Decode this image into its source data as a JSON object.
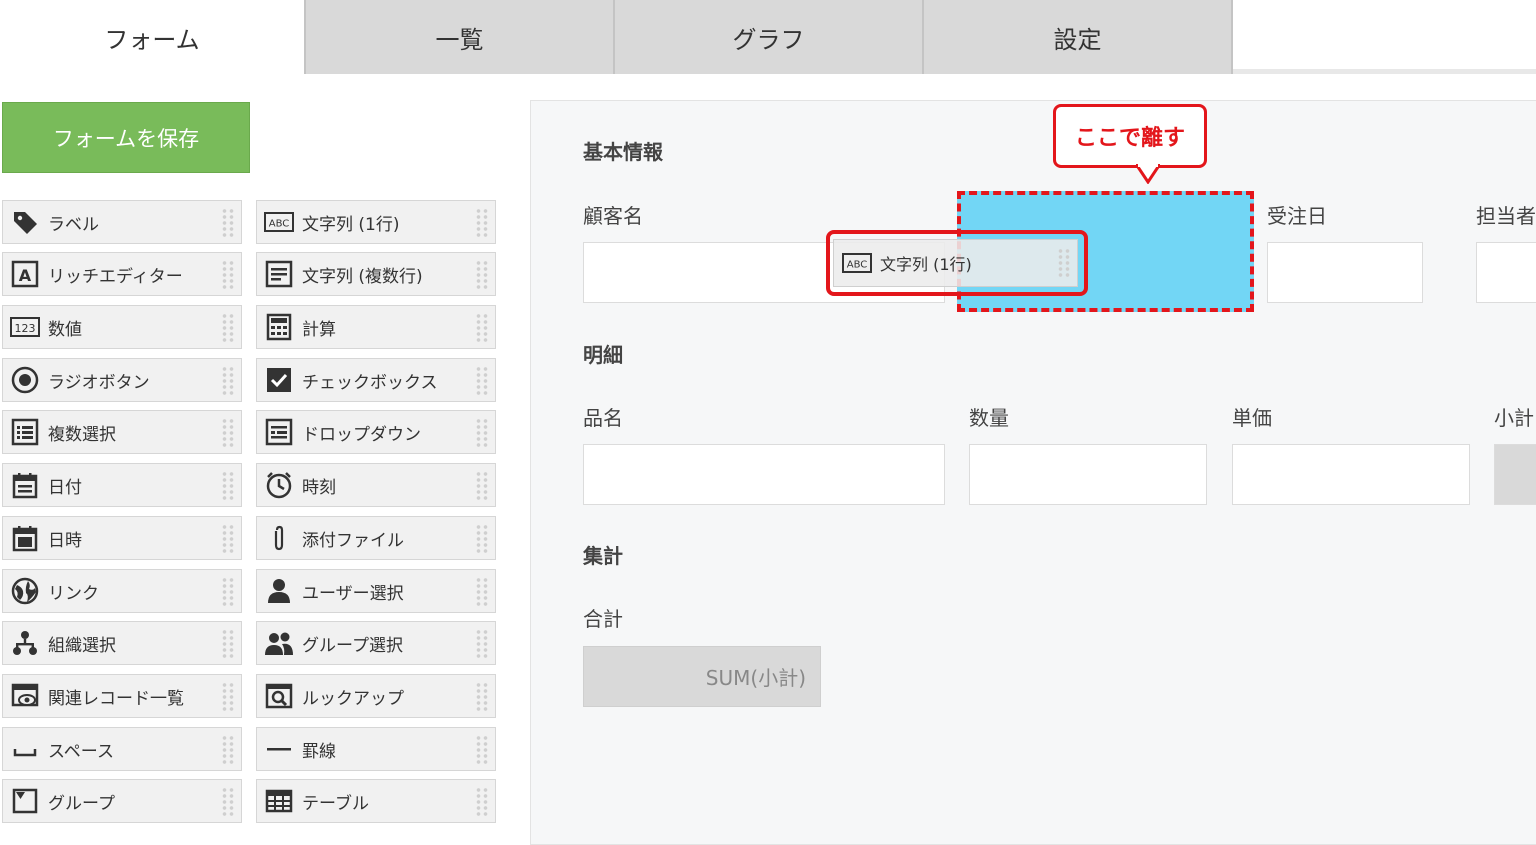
{
  "tabs": [
    {
      "label": "フォーム",
      "active": true
    },
    {
      "label": "一覧",
      "active": false
    },
    {
      "label": "グラフ",
      "active": false
    },
    {
      "label": "設定",
      "active": false
    }
  ],
  "save_button": {
    "label": "フォームを保存",
    "color": "#79bb5a"
  },
  "palette": {
    "left": [
      {
        "label": "ラベル",
        "icon": "tag-icon"
      },
      {
        "label": "リッチエディター",
        "icon": "rich-editor-icon"
      },
      {
        "label": "数値",
        "icon": "number-icon"
      },
      {
        "label": "ラジオボタン",
        "icon": "radio-icon"
      },
      {
        "label": "複数選択",
        "icon": "multi-select-icon"
      },
      {
        "label": "日付",
        "icon": "date-icon"
      },
      {
        "label": "日時",
        "icon": "datetime-icon"
      },
      {
        "label": "リンク",
        "icon": "globe-icon"
      },
      {
        "label": "組織選択",
        "icon": "org-icon"
      },
      {
        "label": "関連レコード一覧",
        "icon": "related-records-icon"
      },
      {
        "label": "スペース",
        "icon": "space-icon"
      },
      {
        "label": "グループ",
        "icon": "group-icon"
      }
    ],
    "right": [
      {
        "label": "文字列 (1行)",
        "icon": "abc-icon"
      },
      {
        "label": "文字列 (複数行)",
        "icon": "multiline-icon"
      },
      {
        "label": "計算",
        "icon": "calculator-icon"
      },
      {
        "label": "チェックボックス",
        "icon": "checkbox-icon"
      },
      {
        "label": "ドロップダウン",
        "icon": "dropdown-icon"
      },
      {
        "label": "時刻",
        "icon": "clock-icon"
      },
      {
        "label": "添付ファイル",
        "icon": "paperclip-icon"
      },
      {
        "label": "ユーザー選択",
        "icon": "user-icon"
      },
      {
        "label": "グループ選択",
        "icon": "users-icon"
      },
      {
        "label": "ルックアップ",
        "icon": "lookup-icon"
      },
      {
        "label": "罫線",
        "icon": "line-icon"
      },
      {
        "label": "テーブル",
        "icon": "table-icon"
      }
    ]
  },
  "form": {
    "section_basic": "基本情報",
    "field_customer": "顧客名",
    "field_order_date": "受注日",
    "field_person": "担当者",
    "section_detail": "明細",
    "field_item": "品名",
    "field_qty": "数量",
    "field_price": "単価",
    "field_subtotal": "小計",
    "section_total": "集計",
    "field_total": "合計",
    "total_formula": "SUM(小計)"
  },
  "drag": {
    "label": "文字列 (1行)",
    "icon": "abc-icon"
  },
  "callout": {
    "text": "ここで離す",
    "color": "#e3161b"
  },
  "dropzone_color": "#72d6f5"
}
